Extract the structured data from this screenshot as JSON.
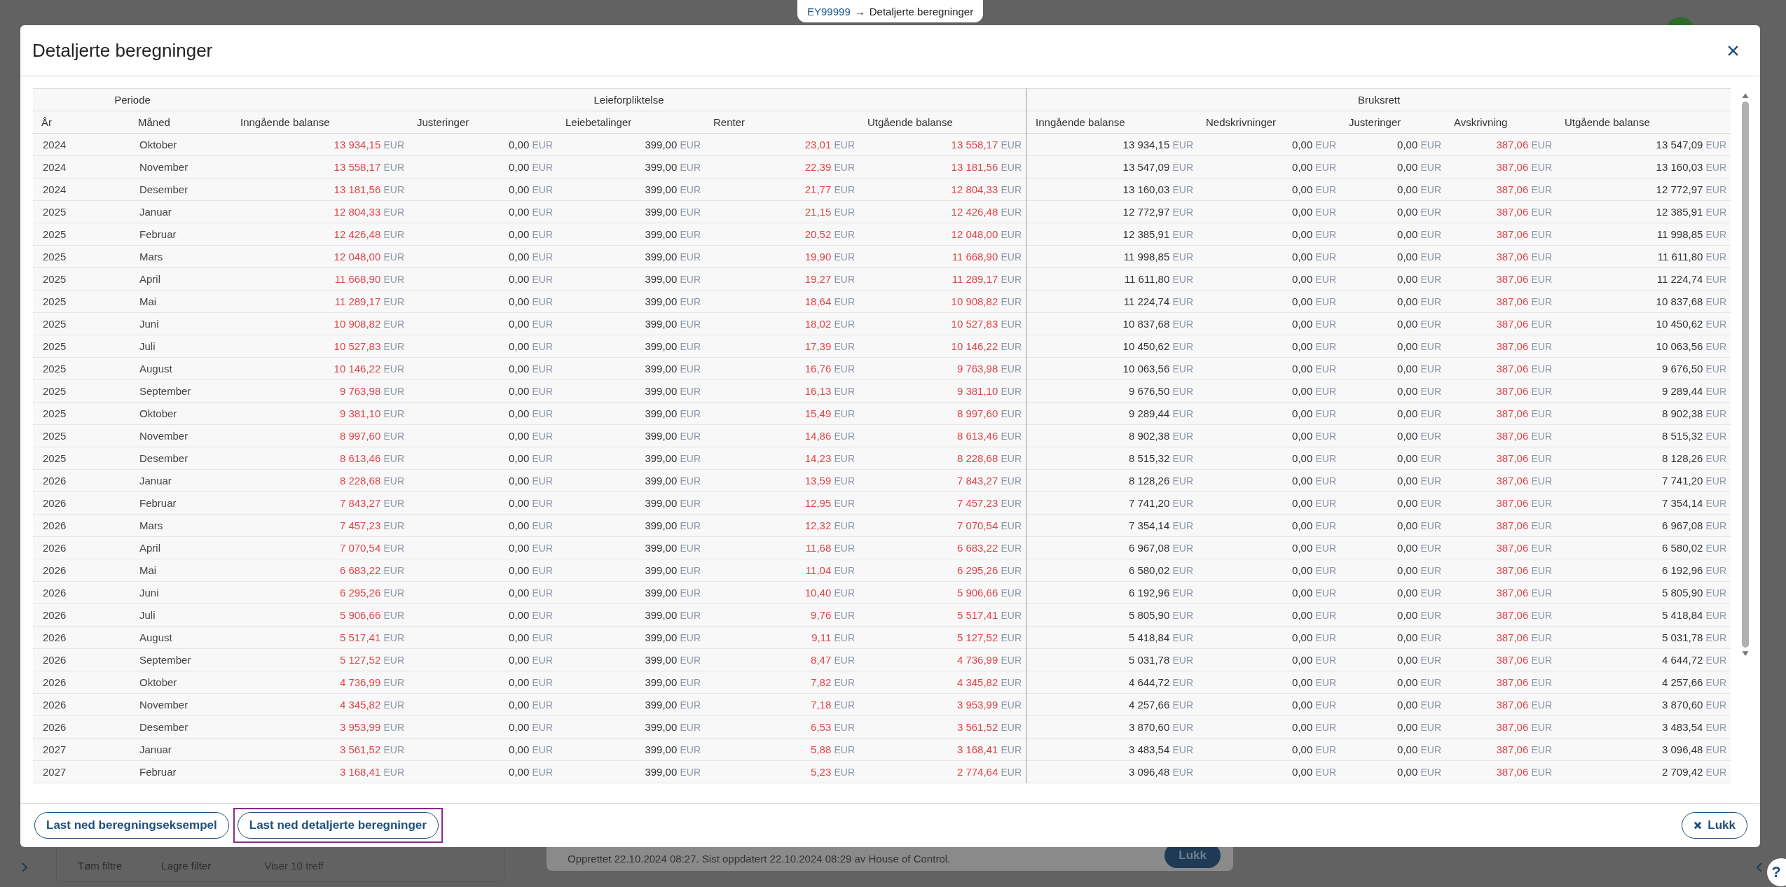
{
  "breadcrumb": {
    "link": "EY99999",
    "arrow": "→",
    "current": "Detaljerte beregninger"
  },
  "background": {
    "filter_actions": [
      "Tøm filtre",
      "Lagre filter"
    ],
    "result_count": "Viser 10 treff",
    "audit_text": "Opprettet 22.10.2024 08:27. Sist oppdatert 22.10.2024 08:29 av House of Control.",
    "close_button": "Lukk",
    "help": "?"
  },
  "modal": {
    "title": "Detaljerte beregninger",
    "table": {
      "groups": [
        {
          "label": "Periode",
          "columns": [
            {
              "label": "År"
            },
            {
              "label": "Måned"
            }
          ]
        },
        {
          "label": "Leieforpliktelse",
          "columns": [
            {
              "label": "Inngående balanse",
              "highlight": true
            },
            {
              "label": "Justeringer",
              "highlight": false
            },
            {
              "label": "Leiebetalinger",
              "highlight": false
            },
            {
              "label": "Renter",
              "highlight": true
            },
            {
              "label": "Utgående balanse",
              "highlight": true
            }
          ]
        },
        {
          "label": "Bruksrett",
          "columns": [
            {
              "label": "Inngående balanse",
              "highlight": false
            },
            {
              "label": "Nedskrivninger",
              "highlight": false
            },
            {
              "label": "Justeringer",
              "highlight": false
            },
            {
              "label": "Avskrivning",
              "highlight": true
            },
            {
              "label": "Utgående balanse",
              "highlight": false
            }
          ]
        }
      ],
      "rows": [
        {
          "year": "2024",
          "month": "Oktober",
          "lease": [
            [
              "13 934,15",
              "EUR"
            ],
            [
              "0,00",
              "EUR"
            ],
            [
              "399,00",
              "EUR"
            ],
            [
              "23,01",
              "EUR"
            ],
            [
              "13 558,17",
              "EUR"
            ]
          ],
          "rou": [
            [
              "13 934,15",
              "EUR"
            ],
            [
              "0,00",
              "EUR"
            ],
            [
              "0,00",
              "EUR"
            ],
            [
              "387,06",
              "EUR"
            ],
            [
              "13 547,09",
              "EUR"
            ]
          ]
        },
        {
          "year": "2024",
          "month": "November",
          "lease": [
            [
              "13 558,17",
              "EUR"
            ],
            [
              "0,00",
              "EUR"
            ],
            [
              "399,00",
              "EUR"
            ],
            [
              "22,39",
              "EUR"
            ],
            [
              "13 181,56",
              "EUR"
            ]
          ],
          "rou": [
            [
              "13 547,09",
              "EUR"
            ],
            [
              "0,00",
              "EUR"
            ],
            [
              "0,00",
              "EUR"
            ],
            [
              "387,06",
              "EUR"
            ],
            [
              "13 160,03",
              "EUR"
            ]
          ]
        },
        {
          "year": "2024",
          "month": "Desember",
          "lease": [
            [
              "13 181,56",
              "EUR"
            ],
            [
              "0,00",
              "EUR"
            ],
            [
              "399,00",
              "EUR"
            ],
            [
              "21,77",
              "EUR"
            ],
            [
              "12 804,33",
              "EUR"
            ]
          ],
          "rou": [
            [
              "13 160,03",
              "EUR"
            ],
            [
              "0,00",
              "EUR"
            ],
            [
              "0,00",
              "EUR"
            ],
            [
              "387,06",
              "EUR"
            ],
            [
              "12 772,97",
              "EUR"
            ]
          ]
        },
        {
          "year": "2025",
          "month": "Januar",
          "lease": [
            [
              "12 804,33",
              "EUR"
            ],
            [
              "0,00",
              "EUR"
            ],
            [
              "399,00",
              "EUR"
            ],
            [
              "21,15",
              "EUR"
            ],
            [
              "12 426,48",
              "EUR"
            ]
          ],
          "rou": [
            [
              "12 772,97",
              "EUR"
            ],
            [
              "0,00",
              "EUR"
            ],
            [
              "0,00",
              "EUR"
            ],
            [
              "387,06",
              "EUR"
            ],
            [
              "12 385,91",
              "EUR"
            ]
          ]
        },
        {
          "year": "2025",
          "month": "Februar",
          "lease": [
            [
              "12 426,48",
              "EUR"
            ],
            [
              "0,00",
              "EUR"
            ],
            [
              "399,00",
              "EUR"
            ],
            [
              "20,52",
              "EUR"
            ],
            [
              "12 048,00",
              "EUR"
            ]
          ],
          "rou": [
            [
              "12 385,91",
              "EUR"
            ],
            [
              "0,00",
              "EUR"
            ],
            [
              "0,00",
              "EUR"
            ],
            [
              "387,06",
              "EUR"
            ],
            [
              "11 998,85",
              "EUR"
            ]
          ]
        },
        {
          "year": "2025",
          "month": "Mars",
          "lease": [
            [
              "12 048,00",
              "EUR"
            ],
            [
              "0,00",
              "EUR"
            ],
            [
              "399,00",
              "EUR"
            ],
            [
              "19,90",
              "EUR"
            ],
            [
              "11 668,90",
              "EUR"
            ]
          ],
          "rou": [
            [
              "11 998,85",
              "EUR"
            ],
            [
              "0,00",
              "EUR"
            ],
            [
              "0,00",
              "EUR"
            ],
            [
              "387,06",
              "EUR"
            ],
            [
              "11 611,80",
              "EUR"
            ]
          ]
        },
        {
          "year": "2025",
          "month": "April",
          "lease": [
            [
              "11 668,90",
              "EUR"
            ],
            [
              "0,00",
              "EUR"
            ],
            [
              "399,00",
              "EUR"
            ],
            [
              "19,27",
              "EUR"
            ],
            [
              "11 289,17",
              "EUR"
            ]
          ],
          "rou": [
            [
              "11 611,80",
              "EUR"
            ],
            [
              "0,00",
              "EUR"
            ],
            [
              "0,00",
              "EUR"
            ],
            [
              "387,06",
              "EUR"
            ],
            [
              "11 224,74",
              "EUR"
            ]
          ]
        },
        {
          "year": "2025",
          "month": "Mai",
          "lease": [
            [
              "11 289,17",
              "EUR"
            ],
            [
              "0,00",
              "EUR"
            ],
            [
              "399,00",
              "EUR"
            ],
            [
              "18,64",
              "EUR"
            ],
            [
              "10 908,82",
              "EUR"
            ]
          ],
          "rou": [
            [
              "11 224,74",
              "EUR"
            ],
            [
              "0,00",
              "EUR"
            ],
            [
              "0,00",
              "EUR"
            ],
            [
              "387,06",
              "EUR"
            ],
            [
              "10 837,68",
              "EUR"
            ]
          ]
        },
        {
          "year": "2025",
          "month": "Juni",
          "lease": [
            [
              "10 908,82",
              "EUR"
            ],
            [
              "0,00",
              "EUR"
            ],
            [
              "399,00",
              "EUR"
            ],
            [
              "18,02",
              "EUR"
            ],
            [
              "10 527,83",
              "EUR"
            ]
          ],
          "rou": [
            [
              "10 837,68",
              "EUR"
            ],
            [
              "0,00",
              "EUR"
            ],
            [
              "0,00",
              "EUR"
            ],
            [
              "387,06",
              "EUR"
            ],
            [
              "10 450,62",
              "EUR"
            ]
          ]
        },
        {
          "year": "2025",
          "month": "Juli",
          "lease": [
            [
              "10 527,83",
              "EUR"
            ],
            [
              "0,00",
              "EUR"
            ],
            [
              "399,00",
              "EUR"
            ],
            [
              "17,39",
              "EUR"
            ],
            [
              "10 146,22",
              "EUR"
            ]
          ],
          "rou": [
            [
              "10 450,62",
              "EUR"
            ],
            [
              "0,00",
              "EUR"
            ],
            [
              "0,00",
              "EUR"
            ],
            [
              "387,06",
              "EUR"
            ],
            [
              "10 063,56",
              "EUR"
            ]
          ]
        },
        {
          "year": "2025",
          "month": "August",
          "lease": [
            [
              "10 146,22",
              "EUR"
            ],
            [
              "0,00",
              "EUR"
            ],
            [
              "399,00",
              "EUR"
            ],
            [
              "16,76",
              "EUR"
            ],
            [
              "9 763,98",
              "EUR"
            ]
          ],
          "rou": [
            [
              "10 063,56",
              "EUR"
            ],
            [
              "0,00",
              "EUR"
            ],
            [
              "0,00",
              "EUR"
            ],
            [
              "387,06",
              "EUR"
            ],
            [
              "9 676,50",
              "EUR"
            ]
          ]
        },
        {
          "year": "2025",
          "month": "September",
          "lease": [
            [
              "9 763,98",
              "EUR"
            ],
            [
              "0,00",
              "EUR"
            ],
            [
              "399,00",
              "EUR"
            ],
            [
              "16,13",
              "EUR"
            ],
            [
              "9 381,10",
              "EUR"
            ]
          ],
          "rou": [
            [
              "9 676,50",
              "EUR"
            ],
            [
              "0,00",
              "EUR"
            ],
            [
              "0,00",
              "EUR"
            ],
            [
              "387,06",
              "EUR"
            ],
            [
              "9 289,44",
              "EUR"
            ]
          ]
        },
        {
          "year": "2025",
          "month": "Oktober",
          "lease": [
            [
              "9 381,10",
              "EUR"
            ],
            [
              "0,00",
              "EUR"
            ],
            [
              "399,00",
              "EUR"
            ],
            [
              "15,49",
              "EUR"
            ],
            [
              "8 997,60",
              "EUR"
            ]
          ],
          "rou": [
            [
              "9 289,44",
              "EUR"
            ],
            [
              "0,00",
              "EUR"
            ],
            [
              "0,00",
              "EUR"
            ],
            [
              "387,06",
              "EUR"
            ],
            [
              "8 902,38",
              "EUR"
            ]
          ]
        },
        {
          "year": "2025",
          "month": "November",
          "lease": [
            [
              "8 997,60",
              "EUR"
            ],
            [
              "0,00",
              "EUR"
            ],
            [
              "399,00",
              "EUR"
            ],
            [
              "14,86",
              "EUR"
            ],
            [
              "8 613,46",
              "EUR"
            ]
          ],
          "rou": [
            [
              "8 902,38",
              "EUR"
            ],
            [
              "0,00",
              "EUR"
            ],
            [
              "0,00",
              "EUR"
            ],
            [
              "387,06",
              "EUR"
            ],
            [
              "8 515,32",
              "EUR"
            ]
          ]
        },
        {
          "year": "2025",
          "month": "Desember",
          "lease": [
            [
              "8 613,46",
              "EUR"
            ],
            [
              "0,00",
              "EUR"
            ],
            [
              "399,00",
              "EUR"
            ],
            [
              "14,23",
              "EUR"
            ],
            [
              "8 228,68",
              "EUR"
            ]
          ],
          "rou": [
            [
              "8 515,32",
              "EUR"
            ],
            [
              "0,00",
              "EUR"
            ],
            [
              "0,00",
              "EUR"
            ],
            [
              "387,06",
              "EUR"
            ],
            [
              "8 128,26",
              "EUR"
            ]
          ]
        },
        {
          "year": "2026",
          "month": "Januar",
          "lease": [
            [
              "8 228,68",
              "EUR"
            ],
            [
              "0,00",
              "EUR"
            ],
            [
              "399,00",
              "EUR"
            ],
            [
              "13,59",
              "EUR"
            ],
            [
              "7 843,27",
              "EUR"
            ]
          ],
          "rou": [
            [
              "8 128,26",
              "EUR"
            ],
            [
              "0,00",
              "EUR"
            ],
            [
              "0,00",
              "EUR"
            ],
            [
              "387,06",
              "EUR"
            ],
            [
              "7 741,20",
              "EUR"
            ]
          ]
        },
        {
          "year": "2026",
          "month": "Februar",
          "lease": [
            [
              "7 843,27",
              "EUR"
            ],
            [
              "0,00",
              "EUR"
            ],
            [
              "399,00",
              "EUR"
            ],
            [
              "12,95",
              "EUR"
            ],
            [
              "7 457,23",
              "EUR"
            ]
          ],
          "rou": [
            [
              "7 741,20",
              "EUR"
            ],
            [
              "0,00",
              "EUR"
            ],
            [
              "0,00",
              "EUR"
            ],
            [
              "387,06",
              "EUR"
            ],
            [
              "7 354,14",
              "EUR"
            ]
          ]
        },
        {
          "year": "2026",
          "month": "Mars",
          "lease": [
            [
              "7 457,23",
              "EUR"
            ],
            [
              "0,00",
              "EUR"
            ],
            [
              "399,00",
              "EUR"
            ],
            [
              "12,32",
              "EUR"
            ],
            [
              "7 070,54",
              "EUR"
            ]
          ],
          "rou": [
            [
              "7 354,14",
              "EUR"
            ],
            [
              "0,00",
              "EUR"
            ],
            [
              "0,00",
              "EUR"
            ],
            [
              "387,06",
              "EUR"
            ],
            [
              "6 967,08",
              "EUR"
            ]
          ]
        },
        {
          "year": "2026",
          "month": "April",
          "lease": [
            [
              "7 070,54",
              "EUR"
            ],
            [
              "0,00",
              "EUR"
            ],
            [
              "399,00",
              "EUR"
            ],
            [
              "11,68",
              "EUR"
            ],
            [
              "6 683,22",
              "EUR"
            ]
          ],
          "rou": [
            [
              "6 967,08",
              "EUR"
            ],
            [
              "0,00",
              "EUR"
            ],
            [
              "0,00",
              "EUR"
            ],
            [
              "387,06",
              "EUR"
            ],
            [
              "6 580,02",
              "EUR"
            ]
          ]
        },
        {
          "year": "2026",
          "month": "Mai",
          "lease": [
            [
              "6 683,22",
              "EUR"
            ],
            [
              "0,00",
              "EUR"
            ],
            [
              "399,00",
              "EUR"
            ],
            [
              "11,04",
              "EUR"
            ],
            [
              "6 295,26",
              "EUR"
            ]
          ],
          "rou": [
            [
              "6 580,02",
              "EUR"
            ],
            [
              "0,00",
              "EUR"
            ],
            [
              "0,00",
              "EUR"
            ],
            [
              "387,06",
              "EUR"
            ],
            [
              "6 192,96",
              "EUR"
            ]
          ]
        },
        {
          "year": "2026",
          "month": "Juni",
          "lease": [
            [
              "6 295,26",
              "EUR"
            ],
            [
              "0,00",
              "EUR"
            ],
            [
              "399,00",
              "EUR"
            ],
            [
              "10,40",
              "EUR"
            ],
            [
              "5 906,66",
              "EUR"
            ]
          ],
          "rou": [
            [
              "6 192,96",
              "EUR"
            ],
            [
              "0,00",
              "EUR"
            ],
            [
              "0,00",
              "EUR"
            ],
            [
              "387,06",
              "EUR"
            ],
            [
              "5 805,90",
              "EUR"
            ]
          ]
        },
        {
          "year": "2026",
          "month": "Juli",
          "lease": [
            [
              "5 906,66",
              "EUR"
            ],
            [
              "0,00",
              "EUR"
            ],
            [
              "399,00",
              "EUR"
            ],
            [
              "9,76",
              "EUR"
            ],
            [
              "5 517,41",
              "EUR"
            ]
          ],
          "rou": [
            [
              "5 805,90",
              "EUR"
            ],
            [
              "0,00",
              "EUR"
            ],
            [
              "0,00",
              "EUR"
            ],
            [
              "387,06",
              "EUR"
            ],
            [
              "5 418,84",
              "EUR"
            ]
          ]
        },
        {
          "year": "2026",
          "month": "August",
          "lease": [
            [
              "5 517,41",
              "EUR"
            ],
            [
              "0,00",
              "EUR"
            ],
            [
              "399,00",
              "EUR"
            ],
            [
              "9,11",
              "EUR"
            ],
            [
              "5 127,52",
              "EUR"
            ]
          ],
          "rou": [
            [
              "5 418,84",
              "EUR"
            ],
            [
              "0,00",
              "EUR"
            ],
            [
              "0,00",
              "EUR"
            ],
            [
              "387,06",
              "EUR"
            ],
            [
              "5 031,78",
              "EUR"
            ]
          ]
        },
        {
          "year": "2026",
          "month": "September",
          "lease": [
            [
              "5 127,52",
              "EUR"
            ],
            [
              "0,00",
              "EUR"
            ],
            [
              "399,00",
              "EUR"
            ],
            [
              "8,47",
              "EUR"
            ],
            [
              "4 736,99",
              "EUR"
            ]
          ],
          "rou": [
            [
              "5 031,78",
              "EUR"
            ],
            [
              "0,00",
              "EUR"
            ],
            [
              "0,00",
              "EUR"
            ],
            [
              "387,06",
              "EUR"
            ],
            [
              "4 644,72",
              "EUR"
            ]
          ]
        },
        {
          "year": "2026",
          "month": "Oktober",
          "lease": [
            [
              "4 736,99",
              "EUR"
            ],
            [
              "0,00",
              "EUR"
            ],
            [
              "399,00",
              "EUR"
            ],
            [
              "7,82",
              "EUR"
            ],
            [
              "4 345,82",
              "EUR"
            ]
          ],
          "rou": [
            [
              "4 644,72",
              "EUR"
            ],
            [
              "0,00",
              "EUR"
            ],
            [
              "0,00",
              "EUR"
            ],
            [
              "387,06",
              "EUR"
            ],
            [
              "4 257,66",
              "EUR"
            ]
          ]
        },
        {
          "year": "2026",
          "month": "November",
          "lease": [
            [
              "4 345,82",
              "EUR"
            ],
            [
              "0,00",
              "EUR"
            ],
            [
              "399,00",
              "EUR"
            ],
            [
              "7,18",
              "EUR"
            ],
            [
              "3 953,99",
              "EUR"
            ]
          ],
          "rou": [
            [
              "4 257,66",
              "EUR"
            ],
            [
              "0,00",
              "EUR"
            ],
            [
              "0,00",
              "EUR"
            ],
            [
              "387,06",
              "EUR"
            ],
            [
              "3 870,60",
              "EUR"
            ]
          ]
        },
        {
          "year": "2026",
          "month": "Desember",
          "lease": [
            [
              "3 953,99",
              "EUR"
            ],
            [
              "0,00",
              "EUR"
            ],
            [
              "399,00",
              "EUR"
            ],
            [
              "6,53",
              "EUR"
            ],
            [
              "3 561,52",
              "EUR"
            ]
          ],
          "rou": [
            [
              "3 870,60",
              "EUR"
            ],
            [
              "0,00",
              "EUR"
            ],
            [
              "0,00",
              "EUR"
            ],
            [
              "387,06",
              "EUR"
            ],
            [
              "3 483,54",
              "EUR"
            ]
          ]
        },
        {
          "year": "2027",
          "month": "Januar",
          "lease": [
            [
              "3 561,52",
              "EUR"
            ],
            [
              "0,00",
              "EUR"
            ],
            [
              "399,00",
              "EUR"
            ],
            [
              "5,88",
              "EUR"
            ],
            [
              "3 168,41",
              "EUR"
            ]
          ],
          "rou": [
            [
              "3 483,54",
              "EUR"
            ],
            [
              "0,00",
              "EUR"
            ],
            [
              "0,00",
              "EUR"
            ],
            [
              "387,06",
              "EUR"
            ],
            [
              "3 096,48",
              "EUR"
            ]
          ]
        },
        {
          "year": "2027",
          "month": "Februar",
          "lease": [
            [
              "3 168,41",
              "EUR"
            ],
            [
              "0,00",
              "EUR"
            ],
            [
              "399,00",
              "EUR"
            ],
            [
              "5,23",
              "EUR"
            ],
            [
              "2 774,64",
              "EUR"
            ]
          ],
          "rou": [
            [
              "3 096,48",
              "EUR"
            ],
            [
              "0,00",
              "EUR"
            ],
            [
              "0,00",
              "EUR"
            ],
            [
              "387,06",
              "EUR"
            ],
            [
              "2 709,42",
              "EUR"
            ]
          ]
        }
      ]
    },
    "footer_buttons": [
      {
        "label": "Last ned beregningseksempel",
        "focused": false
      },
      {
        "label": "Last ned detaljerte beregninger",
        "focused": true
      }
    ],
    "close_button": {
      "label": "Lukk"
    }
  }
}
